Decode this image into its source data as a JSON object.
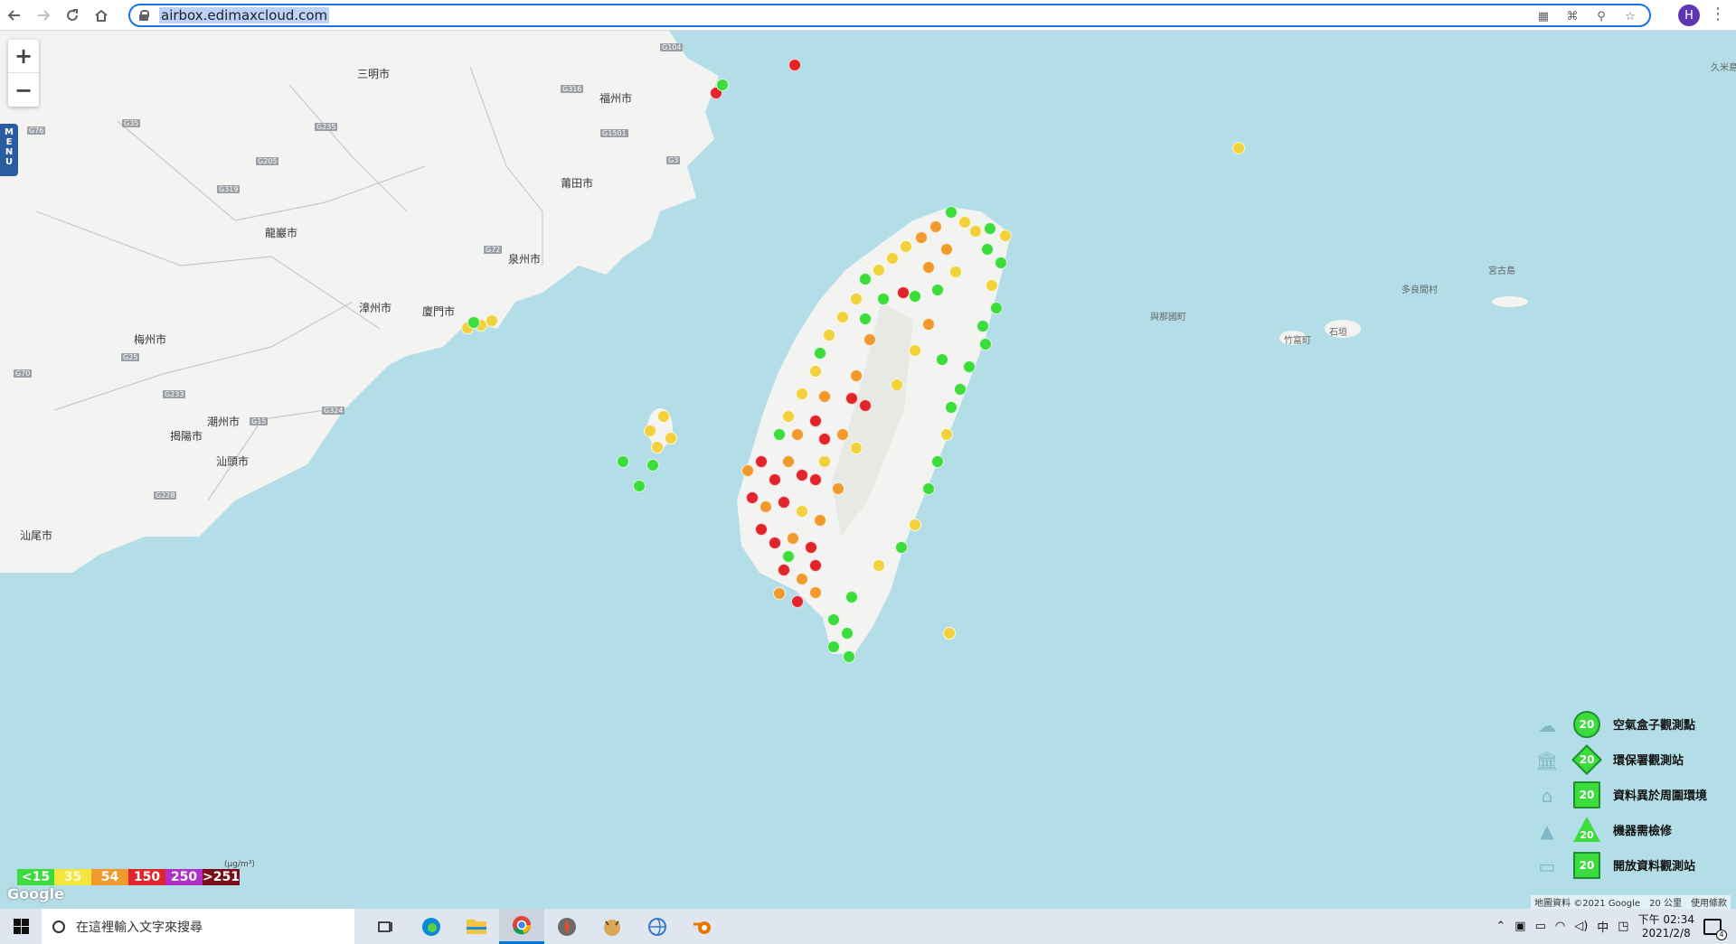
{
  "browser": {
    "url": "airbox.edimaxcloud.com",
    "profile_initial": "H",
    "nav_icons": [
      "back-arrow-icon",
      "forward-arrow-icon",
      "reload-icon",
      "home-icon"
    ],
    "omnibox_icons": [
      "qr-code-icon",
      "translate-icon",
      "zoom-icon",
      "star-icon"
    ]
  },
  "map": {
    "zoom_in": "+",
    "zoom_out": "−",
    "menu_label": "MENU",
    "places": [
      "三明市",
      "福州市",
      "莆田市",
      "龍巖市",
      "泉州市",
      "漳州市",
      "廈門市",
      "梅州市",
      "潮州市",
      "揭陽市",
      "汕頭市",
      "汕尾市",
      "宮古島",
      "石垣",
      "竹富町",
      "多良間村",
      "與那國町",
      "久米島"
    ],
    "roads": [
      "G104",
      "G316",
      "G35",
      "G235",
      "G205",
      "G319",
      "G1501",
      "G3",
      "G72",
      "G25",
      "G15",
      "G324",
      "G228",
      "G76",
      "G70",
      "G233"
    ],
    "google_label": "Google",
    "attribution": "地圖資料 ©2021 Google",
    "scale_label": "20 公里",
    "terms": "使用條款"
  },
  "legend": {
    "badge_value": "20",
    "items": [
      {
        "label": "空氣盒子觀測點",
        "icon": "cloud-icon",
        "shape": "circle"
      },
      {
        "label": "環保署觀測站",
        "icon": "government-building-icon",
        "shape": "diamond"
      },
      {
        "label": "資料異於周圍環境",
        "icon": "house-icon",
        "shape": "house"
      },
      {
        "label": "機器需檢修",
        "icon": "cone-icon",
        "shape": "triangle"
      },
      {
        "label": "開放資料觀測站",
        "icon": "factory-icon",
        "shape": "square"
      }
    ]
  },
  "color_scale": {
    "unit": "(μg/m³)",
    "levels": [
      {
        "label": "<15",
        "color": "#3ddc3d"
      },
      {
        "label": "35",
        "color": "#f2e63c"
      },
      {
        "label": "54",
        "color": "#f09a2d"
      },
      {
        "label": "150",
        "color": "#e2242b"
      },
      {
        "label": "250",
        "color": "#b12fc7"
      },
      {
        "label": ">251",
        "color": "#7a0d1c"
      }
    ]
  },
  "taskbar": {
    "search_placeholder": "在這裡輸入文字來搜尋",
    "apps": [
      "task-view-icon",
      "edge-icon",
      "file-explorer-icon",
      "chrome-icon",
      "app-compass-icon",
      "app-cat-icon",
      "app-globe-icon",
      "blender-icon"
    ],
    "time": "下午 02:34",
    "date": "2021/2/8",
    "ime": "中",
    "notification_count": "4"
  },
  "colors": {
    "accent": "#1a73e8",
    "map_water": "#b3dde7",
    "map_land": "#f3f3f1"
  }
}
